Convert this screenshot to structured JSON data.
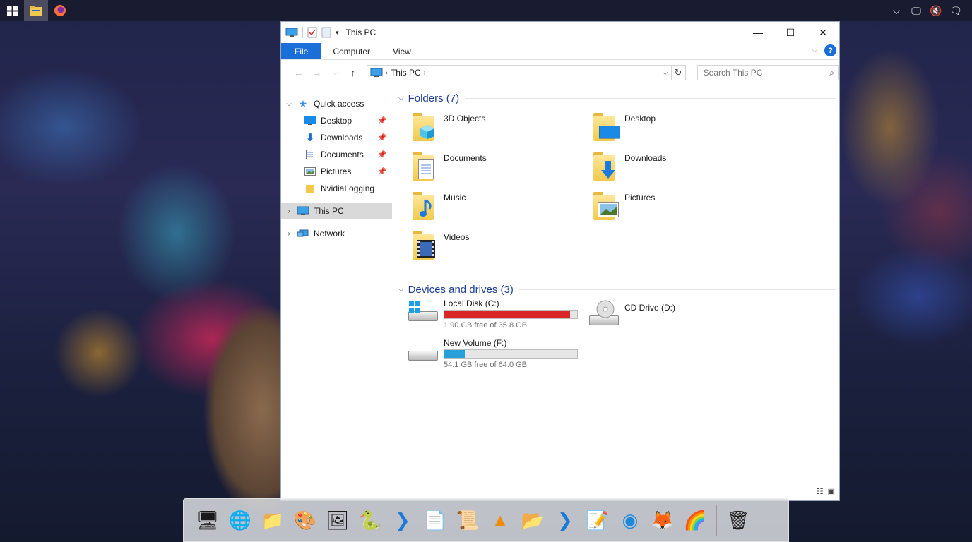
{
  "window": {
    "title": "This PC",
    "tabs": [
      {
        "label": "File"
      },
      {
        "label": "Computer"
      },
      {
        "label": "View"
      }
    ]
  },
  "address": {
    "path": [
      "This PC"
    ],
    "search_placeholder": "Search This PC"
  },
  "sidebar": {
    "quick_access": "Quick access",
    "items": [
      {
        "label": "Desktop",
        "pinned": true
      },
      {
        "label": "Downloads",
        "pinned": true
      },
      {
        "label": "Documents",
        "pinned": true
      },
      {
        "label": "Pictures",
        "pinned": true
      },
      {
        "label": "NvidiaLogging",
        "pinned": false
      }
    ],
    "this_pc": "This PC",
    "network": "Network"
  },
  "folders": {
    "heading": "Folders (7)",
    "items": [
      {
        "label": "3D Objects",
        "icon": "cube-icon"
      },
      {
        "label": "Desktop",
        "icon": "monitor-icon"
      },
      {
        "label": "Documents",
        "icon": "document-icon"
      },
      {
        "label": "Downloads",
        "icon": "down-arrow-icon"
      },
      {
        "label": "Music",
        "icon": "music-note-icon"
      },
      {
        "label": "Pictures",
        "icon": "picture-icon"
      },
      {
        "label": "Videos",
        "icon": "film-icon"
      }
    ]
  },
  "drives": {
    "heading": "Devices and drives (3)",
    "items": [
      {
        "label": "Local Disk (C:)",
        "free": "1.90 GB free of 35.8 GB",
        "used_fraction": 0.947,
        "bar_color": "#da2626"
      },
      {
        "label": "CD Drive (D:)"
      },
      {
        "label": "New Volume (F:)",
        "free": "54.1 GB free of 64.0 GB",
        "used_fraction": 0.155,
        "bar_color": "#26a0da"
      }
    ]
  },
  "colors": {
    "accent": "#1a6ed8",
    "folder_heading": "#1e3f99",
    "selection": "#d9d9d9"
  }
}
